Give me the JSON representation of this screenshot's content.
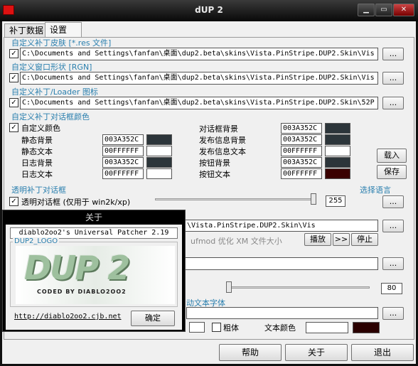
{
  "window": {
    "title": "dUP 2",
    "min": "▁",
    "max": "▭",
    "close": "✕"
  },
  "tabs": [
    {
      "label": "补丁数据"
    },
    {
      "label": "设置"
    }
  ],
  "skin": {
    "label": "自定义补丁皮肤 [*.res 文件]",
    "path": "C:\\Documents and Settings\\fanfan\\桌面\\dup2.beta\\skins\\Vista.PinStripe.DUP2.Skin\\Vis",
    "browse": "...",
    "checked": true
  },
  "window_shape": {
    "label": "自定义窗口形状 [RGN]",
    "path": "C:\\Documents and Settings\\fanfan\\桌面\\dup2.beta\\skins\\Vista.PinStripe.DUP2.Skin\\Vis",
    "browse": "...",
    "checked": true
  },
  "loader_icon": {
    "label": "自定义补丁/Loader 图标",
    "path": "C:\\Documents and Settings\\fanfan\\桌面\\dup2.beta\\skins\\Vista.PinStripe.DUP2.Skin\\52P",
    "browse": "...",
    "checked": true
  },
  "colors": {
    "label": "自定义补丁对话框颜色",
    "custom_label": "自定义颜色",
    "custom_checked": true,
    "left": [
      {
        "label": "静态背景",
        "hex": "003A352C",
        "swatch": "#2C353A"
      },
      {
        "label": "静态文本",
        "hex": "00FFFFFF",
        "swatch": "#FFFFFF"
      },
      {
        "label": "日志背景",
        "hex": "003A352C",
        "swatch": "#2C353A"
      },
      {
        "label": "日志文本",
        "hex": "00FFFFFF",
        "swatch": "#FFFFFF"
      }
    ],
    "right": [
      {
        "label": "对话框背景",
        "hex": "003A352C",
        "swatch": "#2C353A"
      },
      {
        "label": "发布信息背景",
        "hex": "003A352C",
        "swatch": "#2C353A"
      },
      {
        "label": "发布信息文本",
        "hex": "00FFFFFF",
        "swatch": "#FFFFFF"
      },
      {
        "label": "按钮背景",
        "hex": "003A352C",
        "swatch": "#2C353A"
      },
      {
        "label": "按钮文本",
        "hex": "00FFFFFF",
        "swatch": "#3A0000"
      }
    ],
    "load": "载入",
    "save": "保存"
  },
  "transparency": {
    "label": "透明补丁对话框",
    "checkbox_label": "透明对话框 (仅用于 win2k/xp)",
    "checked": true,
    "value": "255",
    "slider_fraction": 1.0
  },
  "language": {
    "label": "选择语言",
    "browse": "..."
  },
  "music": {
    "path_tail": "ufmod 优化 XM 文件大小",
    "play": "播放",
    "next": ">>",
    "stop": "停止"
  },
  "misc": {
    "browse1": "...",
    "slider_value": "80",
    "font_label": "动文本字体",
    "browse2": "...",
    "bold_label": "粗体",
    "bold_checked": false,
    "text_color_label": "文本颜色",
    "text_color_swatch": "#2A0000"
  },
  "footer": {
    "help": "帮助",
    "about": "关于",
    "exit": "退出"
  },
  "about": {
    "title": "关于",
    "version": "diablo2oo2's Universal Patcher 2.19",
    "logo_label": "DUP2_LOGO",
    "logo_text": "DUP 2",
    "coded_by": "CODED BY DIABLO2OO2",
    "url": "http://diablo2oo2.cjb.net",
    "ok": "确定"
  }
}
